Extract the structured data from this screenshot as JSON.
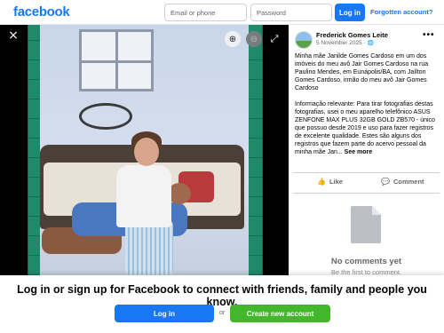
{
  "header": {
    "logo": "facebook",
    "email_placeholder": "Email or phone",
    "password_placeholder": "Password",
    "login_label": "Log in",
    "forgot_label": "Forgotten account?"
  },
  "viewer": {
    "close_icon": "×",
    "zoom_in_icon": "⊕",
    "zoom_out_icon": "⊖",
    "fullscreen_icon": "⤢"
  },
  "post": {
    "author": "Frederick Gomes Leite",
    "date": "5 November 2025",
    "audience_icon": "🌐",
    "more_icon": "•••",
    "paragraph1": "Minha mãe Janilde Gomes Cardoso em um dos imóveis do meu avô Jair Gomes Cardoso na rua Paulino Mendes, em Eunápolis/BA, com Jaílton Gomes Cardoso, irmão do meu avô Jair Gomes Cardoso",
    "paragraph2": "Informação relevante: Para tirar fotografias destas fotografias, usei o meu aparelho telefônico ASUS ZENFONE MAX PLUS 32GB GOLD ZB570 - único que possuo desde 2019 e uso para fazer registros de excelente qualidade. Estes são alguns dos registros que fazem parte do acervo pessoal da minha mãe Jan...",
    "see_more": "See more",
    "like_label": "Like",
    "comment_label": "Comment",
    "like_icon": "👍",
    "comment_icon": "💬",
    "no_comments": "No comments yet",
    "first_comment": "Be the first to comment."
  },
  "banner": {
    "message": "Log in or sign up for Facebook to connect with friends, family and people you know.",
    "login_label": "Log in",
    "or_label": "or",
    "create_label": "Create new account"
  },
  "colors": {
    "brand_blue": "#1877f2",
    "create_green": "#42b72a",
    "photo_frame_green": "#1f8a6a"
  }
}
